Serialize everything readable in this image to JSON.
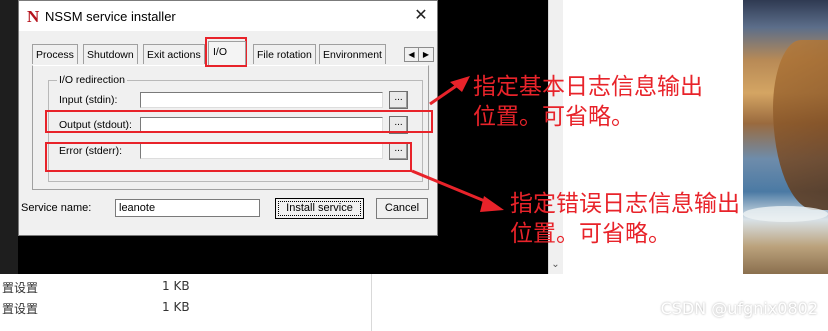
{
  "dialog": {
    "icon_letter": "N",
    "title": "NSSM service installer",
    "close_glyph": "✕",
    "tabs": [
      {
        "label": "Process",
        "active": false
      },
      {
        "label": "Shutdown",
        "active": false
      },
      {
        "label": "Exit actions",
        "active": false
      },
      {
        "label": "I/O",
        "active": true
      },
      {
        "label": "File rotation",
        "active": false
      },
      {
        "label": "Environment",
        "active": false
      }
    ],
    "tab_scroll": {
      "left_glyph": "◀",
      "right_glyph": "▶"
    },
    "io_group": {
      "label": "I/O redirection",
      "rows": [
        {
          "label": "Input (stdin):",
          "value": "",
          "browse": "..."
        },
        {
          "label": "Output (stdout):",
          "value": "",
          "browse": "..."
        },
        {
          "label": "Error (stderr):",
          "value": "",
          "browse": "..."
        }
      ]
    },
    "service_name_label": "Service name:",
    "service_name_value": "leanote",
    "install_label": "Install service",
    "cancel_label": "Cancel"
  },
  "annotations": {
    "stdout_note": [
      "指定基本日志信息输出",
      "位置。可省略。"
    ],
    "stderr_note": [
      "指定错误日志信息输出",
      "位置。可省略。"
    ],
    "color": "#e8232a"
  },
  "explorer": {
    "rows": [
      {
        "name": "置设置",
        "size": "1 KB"
      },
      {
        "name": "置设置",
        "size": "1 KB"
      }
    ]
  },
  "scroll_down_glyph": "⌄",
  "watermark": "CSDN @ufgnix0802"
}
